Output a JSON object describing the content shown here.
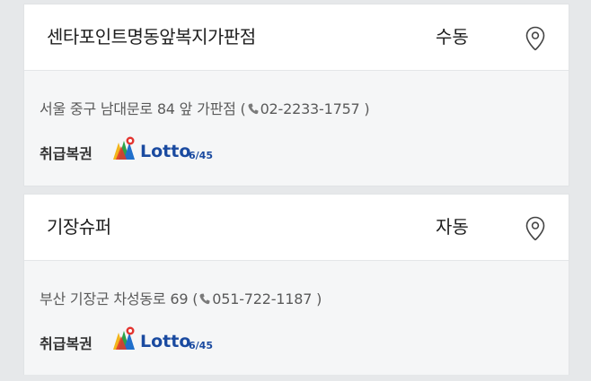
{
  "stores": [
    {
      "name": "센타포인트명동앞복지가판점",
      "draw_type": "수동",
      "address": "서울 중구 남대문로 84 앞 가판점",
      "phone": "02-2233-1757",
      "lottery_label": "취급복권",
      "lottery_logo": {
        "text": "Lotto",
        "suffix": "6/45"
      }
    },
    {
      "name": "기장슈퍼",
      "draw_type": "자동",
      "address": "부산 기장군 차성동로 69",
      "phone": "051-722-1187",
      "lottery_label": "취급복권",
      "lottery_logo": {
        "text": "Lotto",
        "suffix": "6/45"
      }
    }
  ],
  "icons": {
    "map_pin": "map-pin-icon",
    "phone": "phone-icon",
    "clover": "lotto-clover-icon"
  },
  "colors": {
    "background": "#e6e8ea",
    "card_header": "#ffffff",
    "card_body": "#f5f6f7",
    "logo_blue": "#1a4aa0"
  }
}
